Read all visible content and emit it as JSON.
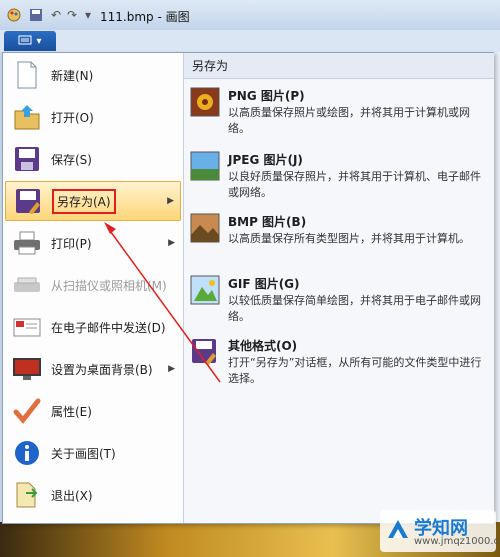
{
  "window": {
    "title": "111.bmp - 画图"
  },
  "file_menu": {
    "icon": "menu-icon",
    "chevron": "▾"
  },
  "menu_items": [
    {
      "label": "新建(N)",
      "icon": "new-file-icon",
      "has_submenu": false,
      "disabled": false
    },
    {
      "label": "打开(O)",
      "icon": "open-folder-icon",
      "has_submenu": false,
      "disabled": false
    },
    {
      "label": "保存(S)",
      "icon": "save-icon",
      "has_submenu": false,
      "disabled": false
    },
    {
      "label": "另存为(A)",
      "icon": "save-as-icon",
      "has_submenu": true,
      "disabled": false,
      "highlighted": true
    },
    {
      "label": "打印(P)",
      "icon": "printer-icon",
      "has_submenu": true,
      "disabled": false
    },
    {
      "label": "从扫描仪或照相机(M)",
      "icon": "scanner-icon",
      "has_submenu": false,
      "disabled": true
    },
    {
      "label": "在电子邮件中发送(D)",
      "icon": "email-icon",
      "has_submenu": false,
      "disabled": false
    },
    {
      "label": "设置为桌面背景(B)",
      "icon": "desktop-icon",
      "has_submenu": true,
      "disabled": false
    },
    {
      "label": "属性(E)",
      "icon": "checkmark-icon",
      "has_submenu": false,
      "disabled": false
    },
    {
      "label": "关于画图(T)",
      "icon": "info-icon",
      "has_submenu": false,
      "disabled": false
    },
    {
      "label": "退出(X)",
      "icon": "exit-icon",
      "has_submenu": false,
      "disabled": false
    }
  ],
  "save_as_panel": {
    "heading": "另存为",
    "options": [
      {
        "title": "PNG 图片(P)",
        "desc": "以高质量保存照片或绘图，并将其用于计算机或网络。",
        "icon": "png-image-icon"
      },
      {
        "title": "JPEG 图片(J)",
        "desc": "以良好质量保存照片，并将其用于计算机、电子邮件或网络。",
        "icon": "jpeg-image-icon"
      },
      {
        "title": "BMP 图片(B)",
        "desc": "以高质量保存所有类型图片，并将其用于计算机。",
        "icon": "bmp-image-icon"
      },
      {
        "title": "GIF 图片(G)",
        "desc": "以较低质量保存简单绘图，并将其用于电子邮件或网络。",
        "icon": "gif-image-icon"
      },
      {
        "title": "其他格式(O)",
        "desc": "打开“另存为”对话框，从所有可能的文件类型中进行选择。",
        "icon": "other-formats-icon"
      }
    ]
  },
  "watermark": {
    "title": "学知网",
    "url": "www.jmqz1000.com"
  },
  "colors": {
    "highlight": "#ffd67a",
    "annotation": "#e02020",
    "ribbon": "#1a4f9c"
  }
}
